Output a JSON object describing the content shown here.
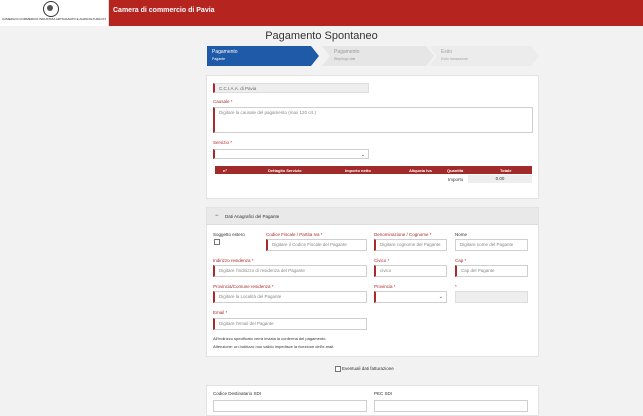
{
  "header": {
    "logo_text": "CAMERA DI COMMERCIO INDUSTRIA ARTIGIANATO E AGRICOLTURA DI PAVIA",
    "site_title": "Camera di commercio di Pavia",
    "brand_color": "#b5241f"
  },
  "page": {
    "title": "Pagamento Spontaneo"
  },
  "stepper": [
    {
      "label": "Pagamento",
      "sub": "Pagante",
      "state": "active"
    },
    {
      "label": "Pagamento",
      "sub": "Riepilogo dati",
      "state": "inactive"
    },
    {
      "label": "Esito",
      "sub": "Esito transazione",
      "state": "inactive"
    }
  ],
  "payment": {
    "ente_value": "C.C.I.A.A. di Pavia",
    "causale_label": "Causale *",
    "causale_placeholder": "Digitare la causale del pagamento (max 120 crt.)",
    "servizio_label": "Servizio *",
    "servizio_value": "",
    "table_headers": [
      "n°",
      "Dettaglio Servizio",
      "Importo netto",
      "Aliquota Iva",
      "Quantità",
      "Totale"
    ],
    "importo_label": "Importo",
    "importo_value": "0.00"
  },
  "anagrafici": {
    "section_title": "Dati Anagrafici del Pagante",
    "soggetto_estero_label": "Soggetto estero",
    "cf_label": "Codice Fiscale / Partita Iva *",
    "cf_placeholder": "Digitare il Codice Fiscale del Pagante",
    "denominazione_label": "Denominazione / Cognome *",
    "denominazione_placeholder": "Digitare cognome del Pagante",
    "nome_label": "Nome",
    "nome_placeholder": "Digitare nome del Pagante",
    "indirizzo_label": "Indirizzo residenza *",
    "indirizzo_placeholder": "Digitare l'indirizzo di residenza del Pagante",
    "civico_label": "Civico *",
    "civico_placeholder": "civico",
    "cap_label": "Cap *",
    "cap_placeholder": "Cap del Pagante",
    "comune_label": "Provincia/Comune residenza *",
    "comune_placeholder": "Digitare la Località del Pagante",
    "provincia_label": "Provincia *",
    "provincia_value": "",
    "extra_label": "*",
    "email_label": "Email *",
    "email_placeholder": "Digitare l'email del Pagante",
    "note_1": "All'indirizzo specificato verrà inviata la conferma del pagamento.",
    "note_2": "Attenzione: un indirizzo non valido impedisce la ricezione dell'e-mail."
  },
  "fatturazione": {
    "checkbox_label": "Eventuali dati fatturazione",
    "sdi_label": "Codice Destinatario SDI",
    "pec_label": "PEC SDI"
  }
}
